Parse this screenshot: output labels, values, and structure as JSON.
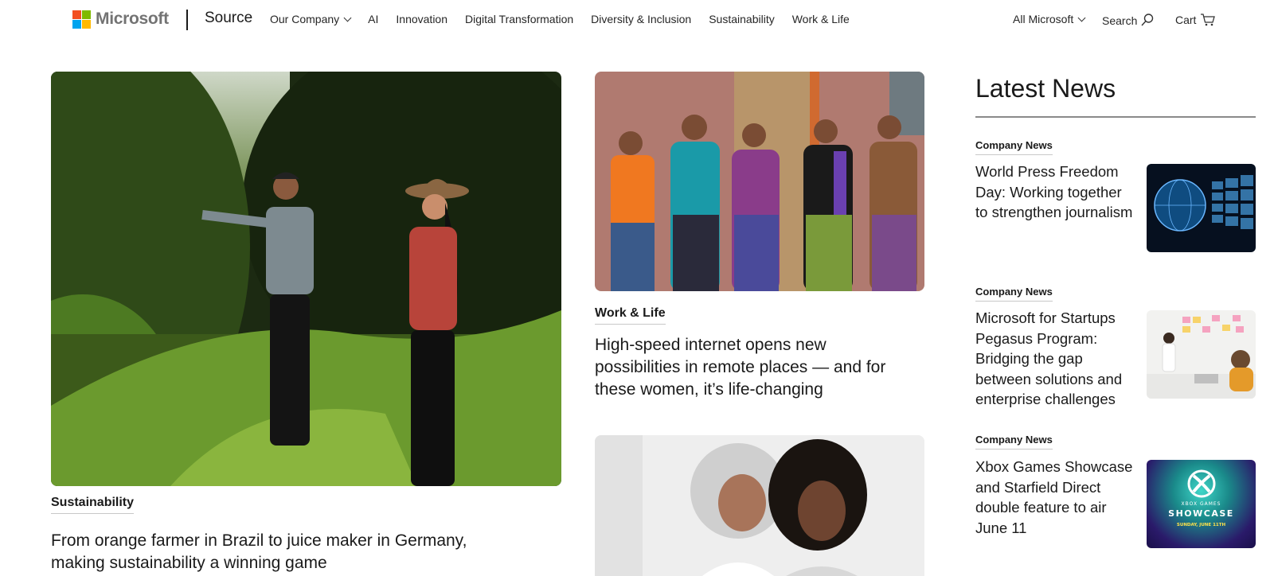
{
  "header": {
    "logo_text": "Microsoft",
    "site_title": "Source",
    "nav": [
      {
        "label": "Our Company",
        "dropdown": true
      },
      {
        "label": "AI",
        "dropdown": false
      },
      {
        "label": "Innovation",
        "dropdown": false
      },
      {
        "label": "Digital Transformation",
        "dropdown": false
      },
      {
        "label": "Diversity & Inclusion",
        "dropdown": false
      },
      {
        "label": "Sustainability",
        "dropdown": false
      },
      {
        "label": "Work & Life",
        "dropdown": false
      }
    ],
    "all_microsoft": "All Microsoft",
    "search": "Search",
    "cart": "Cart"
  },
  "featured": {
    "category": "Sustainability",
    "headline": "From orange farmer in Brazil to juice maker in Germany, making sustainability a winning game"
  },
  "middle": {
    "category": "Work & Life",
    "headline": "High-speed internet opens new possibilities in remote places — and for these women, it’s life-changing"
  },
  "latest": {
    "title": "Latest News",
    "items": [
      {
        "category": "Company News",
        "headline": "World Press Freedom Day: Working together to strengthen journalism"
      },
      {
        "category": "Company News",
        "headline": "Microsoft for Startups Pegasus Program: Bridging the gap between solutions and enterprise challenges"
      },
      {
        "category": "Company News",
        "headline": "Xbox Games Showcase and Starfield Direct double feature to air June 11"
      }
    ],
    "xbox_thumb_text": {
      "line1": "XBOX GAMES",
      "line2": "SHOWCASE",
      "line3": "SUNDAY, JUNE 11TH"
    }
  },
  "colors": {
    "logo_red": "#f25022",
    "logo_green": "#7fba00",
    "logo_blue": "#00a4ef",
    "logo_yellow": "#ffb900"
  }
}
